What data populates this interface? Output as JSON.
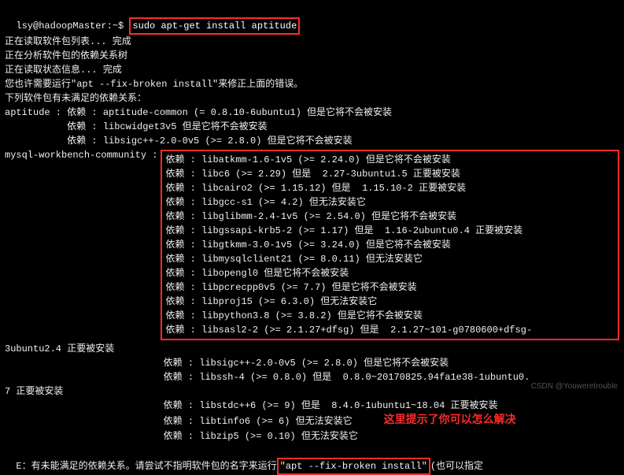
{
  "prompt": {
    "userhost": "lsy@hadoopMaster",
    "sep": ":",
    "path": "~",
    "dollar": "$ ",
    "command": "sudo apt-get install aptitude"
  },
  "pre": {
    "l1": "正在读取软件包列表... 完成",
    "l2": "正在分析软件包的依赖关系树",
    "l3": "正在读取状态信息... 完成",
    "l4": "您也许需要运行\"apt --fix-broken install\"来修正上面的错误。",
    "l5": "下列软件包有未满足的依赖关系："
  },
  "apt": {
    "head": "aptitude : 依赖 : aptitude-common (= 0.8.10-6ubuntu1) 但是它将不会被安装",
    "d1": "           依赖 : libcwidget3v5 但是它将不会被安装",
    "d2": "           依赖 : libsigc++-2.0-0v5 (>= 2.8.0) 但是它将不会被安装"
  },
  "mwc": {
    "head": "mysql-workbench-community :",
    "d0": "依赖 : libatkmm-1.6-1v5 (>= 2.24.0) 但是它将不会被安装",
    "d1": "依赖 : libc6 (>= 2.29) 但是  2.27-3ubuntu1.5 正要被安装",
    "d2": "依赖 : libcairo2 (>= 1.15.12) 但是  1.15.10-2 正要被安装",
    "d3": "依赖 : libgcc-s1 (>= 4.2) 但无法安装它",
    "d4": "依赖 : libglibmm-2.4-1v5 (>= 2.54.0) 但是它将不会被安装",
    "d5": "依赖 : libgssapi-krb5-2 (>= 1.17) 但是  1.16-2ubuntu0.4 正要被安装",
    "d6": "依赖 : libgtkmm-3.0-1v5 (>= 3.24.0) 但是它将不会被安装",
    "d7": "依赖 : libmysqlclient21 (>= 8.0.11) 但无法安装它",
    "d8": "依赖 : libopengl0 但是它将不会被安装",
    "d9": "依赖 : libpcrecpp0v5 (>= 7.7) 但是它将不会被安装",
    "d10": "依赖 : libproj15 (>= 6.3.0) 但无法安装它",
    "d11": "依赖 : libpython3.8 (>= 3.8.2) 但是它将不会被安装",
    "d12": "依赖 : libsasl2-2 (>= 2.1.27+dfsg) 但是  2.1.27~101-g0780600+dfsg-"
  },
  "tail": {
    "t1": "3ubuntu2.4 正要被安装",
    "t2": "                            依赖 : libsigc++-2.0-0v5 (>= 2.8.0) 但是它将不会被安装",
    "t3": "                            依赖 : libssh-4 (>= 0.8.0) 但是  0.8.0~20170825.94fa1e38-1ubuntu0.",
    "t4": "7 正要被安装",
    "t5": "                            依赖 : libstdc++6 (>= 9) 但是  8.4.0-1ubuntu1~18.04 正要被安装",
    "t6": "                            依赖 : libtinfo6 (>= 6) 但无法安装它",
    "t7": "                            依赖 : libzip5 (>= 0.10) 但无法安装它",
    "hint_cn": "这里提示了你可以怎么解决",
    "e1a": "E：有未能满足的依赖关系。请尝试不指明软件包的名字来运行",
    "e1b": "\"apt --fix-broken install\"",
    "e1c": "(也可以指定"
  },
  "watermark": "CSDN @Youweretrouble"
}
